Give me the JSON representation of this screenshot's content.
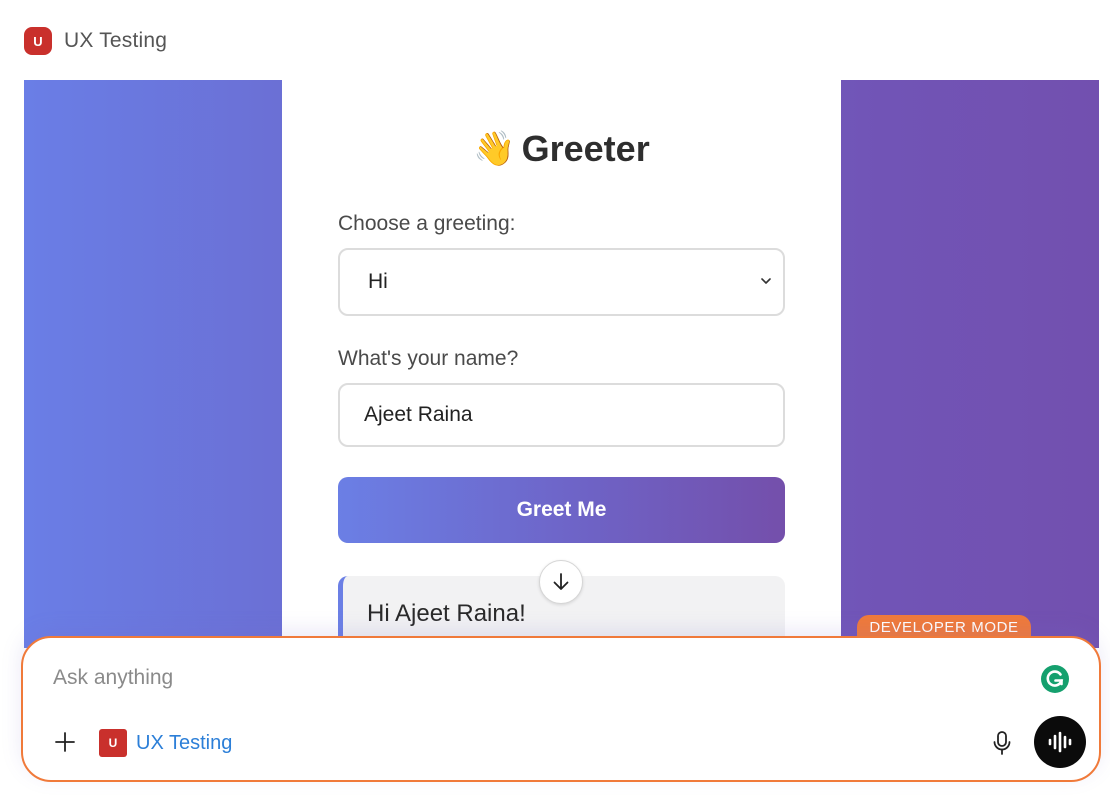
{
  "app": {
    "badge": "U",
    "title": "UX Testing"
  },
  "greeter": {
    "title": "Greeter",
    "title_icon": "waving-hand-emoji",
    "greeting_label": "Choose a greeting:",
    "greeting_selected": "Hi",
    "name_label": "What's your name?",
    "name_value": "Ajeet Raina",
    "button_label": "Greet Me",
    "result_text": "Hi Ajeet Raina!"
  },
  "developer_mode": "DEVELOPER MODE",
  "composer": {
    "placeholder": "Ask anything",
    "chip_badge": "U",
    "chip_label": "UX Testing"
  },
  "colors": {
    "accent_orange": "#f07a3a",
    "gradient_start": "#6a7ee6",
    "gradient_end": "#7250af",
    "app_badge_red": "#c9302c",
    "link_blue": "#2c7fd8"
  },
  "icons": {
    "scroll": "arrow-down-icon",
    "select": "chevron-down-icon",
    "add": "plus-icon",
    "mic": "microphone-icon",
    "voice": "voice-waveform-icon",
    "grammarly": "grammarly-icon"
  }
}
